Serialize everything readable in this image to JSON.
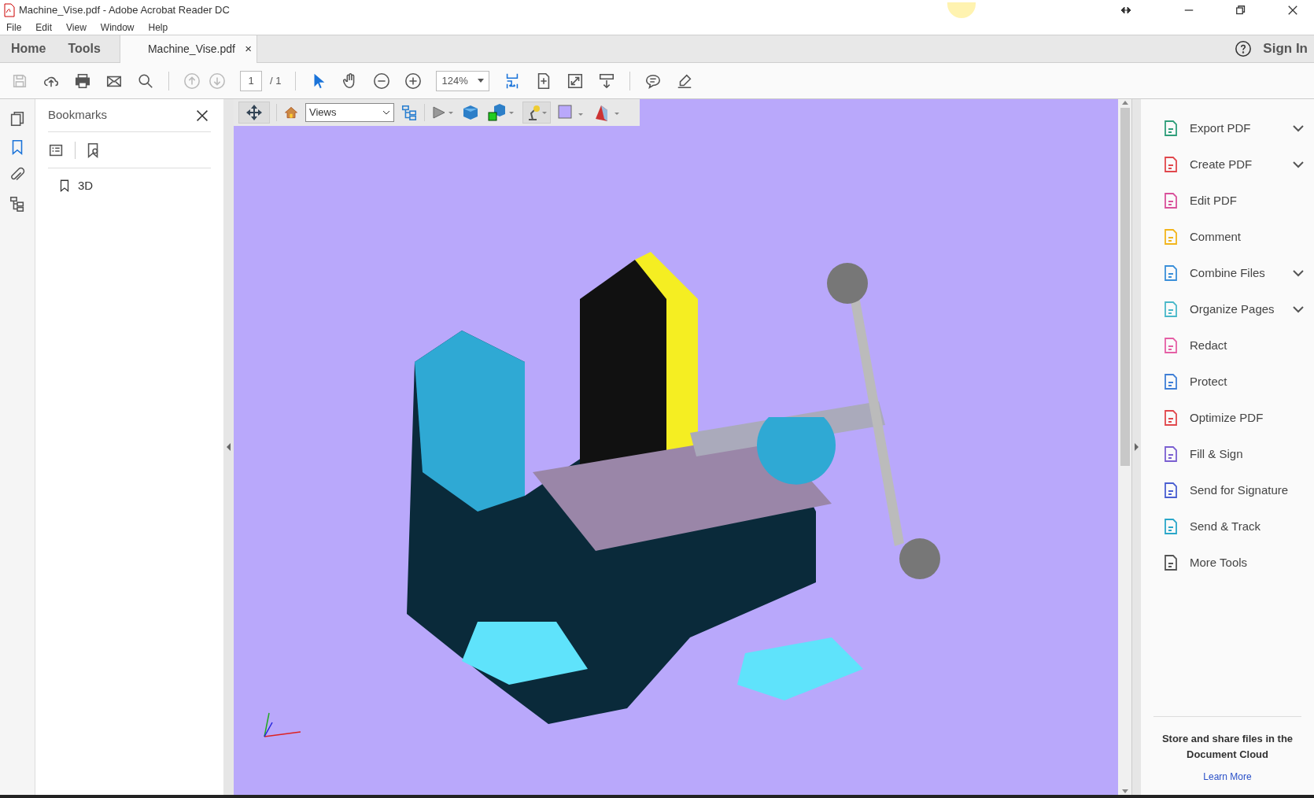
{
  "window": {
    "title": "Machine_Vise.pdf - Adobe Acrobat Reader DC"
  },
  "menu": [
    "File",
    "Edit",
    "View",
    "Window",
    "Help"
  ],
  "nav_tabs": [
    {
      "label": "Home",
      "selected": false
    },
    {
      "label": "Tools",
      "selected": false
    }
  ],
  "document_tab": {
    "label": "Machine_Vise.pdf",
    "close": "×",
    "selected": true
  },
  "help": {
    "label": "Sign In"
  },
  "toolbar": {
    "page": "1",
    "page_total": "/ 1",
    "zoom": "124%"
  },
  "bookmarks": {
    "title": "Bookmarks",
    "items": [
      {
        "label": "3D"
      }
    ]
  },
  "viewer_toolbar": {
    "views": "Views"
  },
  "tools": [
    {
      "label": "Export PDF",
      "color": "#2f9e7a",
      "expandable": true
    },
    {
      "label": "Create PDF",
      "color": "#e0474c",
      "expandable": true
    },
    {
      "label": "Edit PDF",
      "color": "#d9519b",
      "expandable": false
    },
    {
      "label": "Comment",
      "color": "#f2b51c",
      "expandable": false
    },
    {
      "label": "Combine Files",
      "color": "#3a8fd9",
      "expandable": true
    },
    {
      "label": "Organize Pages",
      "color": "#49b8c9",
      "expandable": true
    },
    {
      "label": "Redact",
      "color": "#e55fa5",
      "expandable": false
    },
    {
      "label": "Protect",
      "color": "#3f7fd6",
      "expandable": false
    },
    {
      "label": "Optimize PDF",
      "color": "#e0474c",
      "expandable": false
    },
    {
      "label": "Fill & Sign",
      "color": "#7a5fd1",
      "expandable": false
    },
    {
      "label": "Send for Signature",
      "color": "#4a5fd1",
      "expandable": false
    },
    {
      "label": "Send & Track",
      "color": "#2aa7c9",
      "expandable": false
    },
    {
      "label": "More Tools",
      "color": "#555555",
      "expandable": false
    }
  ],
  "cloud": {
    "text": "Store and share files in the Document Cloud",
    "link": "Learn More"
  }
}
